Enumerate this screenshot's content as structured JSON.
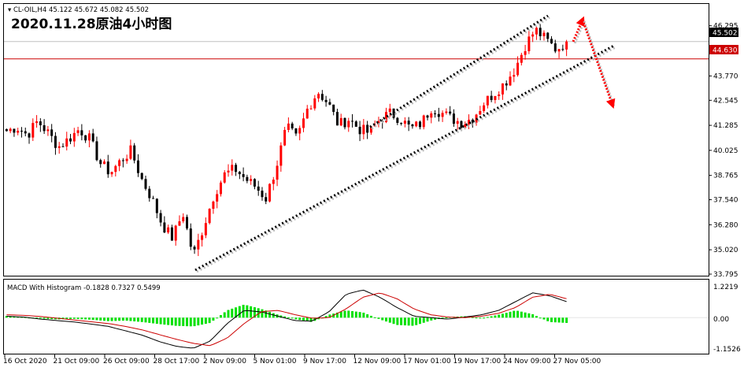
{
  "symbol_line": {
    "symbol": "CL-OIL,H4",
    "open": "45.122",
    "high": "45.672",
    "low": "45.082",
    "close": "45.502"
  },
  "headline": "2020.11.28原油4小时图",
  "macd": {
    "label": "MACD With Histogram",
    "values": [
      "-0.1828",
      "0.7327",
      "0.5499"
    ],
    "axis_labels": [
      "1.2219",
      "0.00",
      "-1.1526"
    ]
  },
  "badges": {
    "bid": "45.502",
    "level": "44.630"
  },
  "colors": {
    "bull_candle": "#ff0000",
    "bear_candle": "#000000",
    "level_line": "#cc0000",
    "macd_histogram": "#00e000",
    "macd_line": "#000000",
    "signal_line": "#cc0000",
    "channel_lines": "#000000",
    "forecast_arrows": "#ff0000"
  },
  "chart_data": [
    {
      "type": "candlestick",
      "title": "",
      "ylim": [
        33.795,
        46.8
      ],
      "yticks": [
        "46.295",
        "45.030",
        "43.770",
        "42.545",
        "41.285",
        "40.025",
        "38.765",
        "37.540",
        "36.280",
        "35.020",
        "33.795"
      ],
      "xticks": [
        "16 Oct 2020",
        "21 Oct 09:00",
        "26 Oct 09:00",
        "28 Oct 17:00",
        "2 Nov 09:00",
        "5 Nov 01:00",
        "9 Nov 17:00",
        "12 Nov 09:00",
        "17 Nov 01:00",
        "19 Nov 17:00",
        "24 Nov 09:00",
        "27 Nov 05:00"
      ],
      "horizontal_lines": [
        44.63
      ],
      "path": [
        41.0,
        41.2,
        40.8,
        41.5,
        40.9,
        40.2,
        40.6,
        41.1,
        40.6,
        39.4,
        38.9,
        39.5,
        40.0,
        38.6,
        37.6,
        36.3,
        35.6,
        36.9,
        34.7,
        36.2,
        37.8,
        38.8,
        39.1,
        38.6,
        38.2,
        37.6,
        39.2,
        41.2,
        40.6,
        42.1,
        43.0,
        42.4,
        41.3,
        41.6,
        41.1,
        40.9,
        41.6,
        41.9,
        41.6,
        41.1,
        41.4,
        42.2,
        41.9,
        41.6,
        41.4,
        41.7,
        42.4,
        42.9,
        43.4,
        44.1,
        45.3,
        46.1,
        45.6,
        45.1,
        45.5
      ],
      "trend_channel": {
        "lower_line": [
          [
            34.0,
            0
          ],
          [
            45.3,
            1
          ]
        ],
        "upper_line": [
          [
            41.2,
            0
          ],
          [
            46.8,
            1
          ]
        ],
        "forecast": [
          45.5,
          46.6,
          42.3
        ]
      }
    },
    {
      "type": "macd",
      "title": "MACD With Histogram",
      "ylim": [
        -1.1526,
        1.2219
      ],
      "values": {
        "histogram": -0.1828,
        "macd": 0.7327,
        "signal": 0.5499
      },
      "histogram_path": [
        0.06,
        0.02,
        -0.03,
        -0.06,
        -0.04,
        -0.07,
        -0.12,
        -0.1,
        -0.15,
        -0.22,
        -0.28,
        -0.3,
        -0.18,
        0.25,
        0.45,
        0.3,
        0.1,
        -0.05,
        -0.15,
        0.1,
        0.25,
        0.18,
        -0.06,
        -0.25,
        -0.28,
        -0.1,
        0.02,
        0.05,
        -0.02,
        0.1,
        0.25,
        0.12,
        -0.15,
        -0.18
      ],
      "macd_path": [
        0.05,
        0.02,
        -0.05,
        -0.1,
        -0.15,
        -0.22,
        -0.3,
        -0.45,
        -0.6,
        -0.82,
        -0.98,
        -1.05,
        -0.8,
        -0.2,
        0.25,
        0.2,
        0.05,
        -0.1,
        -0.12,
        0.2,
        0.8,
        0.95,
        0.7,
        0.35,
        0.05,
        0.0,
        -0.05,
        0.02,
        0.1,
        0.25,
        0.55,
        0.85,
        0.75,
        0.55
      ],
      "signal_path": [
        0.1,
        0.08,
        0.04,
        -0.02,
        -0.08,
        -0.14,
        -0.2,
        -0.3,
        -0.42,
        -0.58,
        -0.74,
        -0.88,
        -0.96,
        -0.7,
        -0.2,
        0.2,
        0.25,
        0.1,
        -0.02,
        0.0,
        0.3,
        0.7,
        0.85,
        0.65,
        0.3,
        0.1,
        0.02,
        0.0,
        0.05,
        0.15,
        0.35,
        0.7,
        0.8,
        0.65
      ]
    }
  ]
}
